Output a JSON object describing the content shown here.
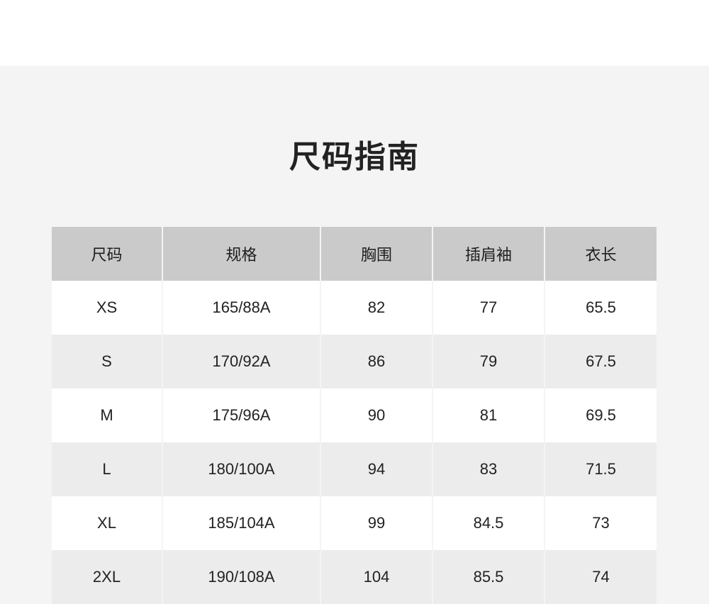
{
  "title": "尺码指南",
  "table": {
    "headers": [
      "尺码",
      "规格",
      "胸围",
      "插肩袖",
      "衣长"
    ],
    "rows": [
      [
        "XS",
        "165/88A",
        "82",
        "77",
        "65.5"
      ],
      [
        "S",
        "170/92A",
        "86",
        "79",
        "67.5"
      ],
      [
        "M",
        "175/96A",
        "90",
        "81",
        "69.5"
      ],
      [
        "L",
        "180/100A",
        "94",
        "83",
        "71.5"
      ],
      [
        "XL",
        "185/104A",
        "99",
        "84.5",
        "73"
      ],
      [
        "2XL",
        "190/108A",
        "104",
        "85.5",
        "74"
      ]
    ]
  }
}
